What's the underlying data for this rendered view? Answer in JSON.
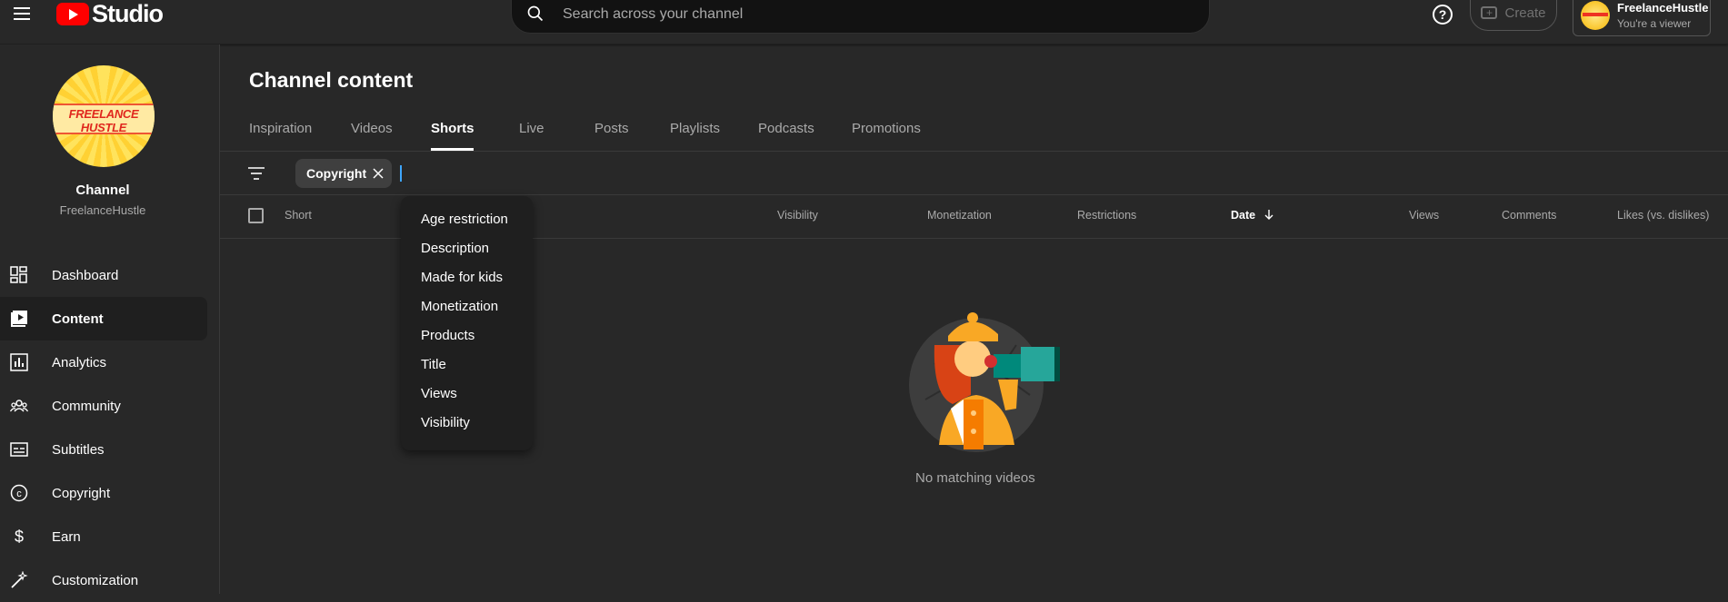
{
  "app": {
    "logo_text": "Studio"
  },
  "search": {
    "placeholder": "Search across your channel"
  },
  "header": {
    "create_label": "Create",
    "account_name": "FreelanceHustle",
    "account_role": "You're a viewer"
  },
  "sidebar": {
    "channel_title": "Channel",
    "channel_handle": "FreelanceHustle",
    "avatar_text": "FREELANCE HUSTLE",
    "items": [
      {
        "label": "Dashboard",
        "icon": "dashboard-icon"
      },
      {
        "label": "Content",
        "icon": "content-icon",
        "active": true
      },
      {
        "label": "Analytics",
        "icon": "analytics-icon"
      },
      {
        "label": "Community",
        "icon": "community-icon"
      },
      {
        "label": "Subtitles",
        "icon": "subtitles-icon"
      },
      {
        "label": "Copyright",
        "icon": "copyright-icon"
      },
      {
        "label": "Earn",
        "icon": "earn-icon"
      },
      {
        "label": "Customization",
        "icon": "customization-icon"
      }
    ]
  },
  "main": {
    "title": "Channel content",
    "tabs": [
      "Inspiration",
      "Videos",
      "Shorts",
      "Live",
      "Posts",
      "Playlists",
      "Podcasts",
      "Promotions"
    ],
    "active_tab": "Shorts",
    "filter_chip": "Copyright",
    "columns": [
      "Short",
      "Visibility",
      "Monetization",
      "Restrictions",
      "Date",
      "Views",
      "Comments",
      "Likes (vs. dislikes)"
    ],
    "sorted_column": "Date",
    "empty_message": "No matching videos"
  },
  "dropdown": {
    "items": [
      "Age restriction",
      "Description",
      "Made for kids",
      "Monetization",
      "Products",
      "Title",
      "Views",
      "Visibility"
    ]
  },
  "colors": {
    "accent": "#3ea6ff",
    "brand": "#ff0000",
    "background": "#282828"
  }
}
